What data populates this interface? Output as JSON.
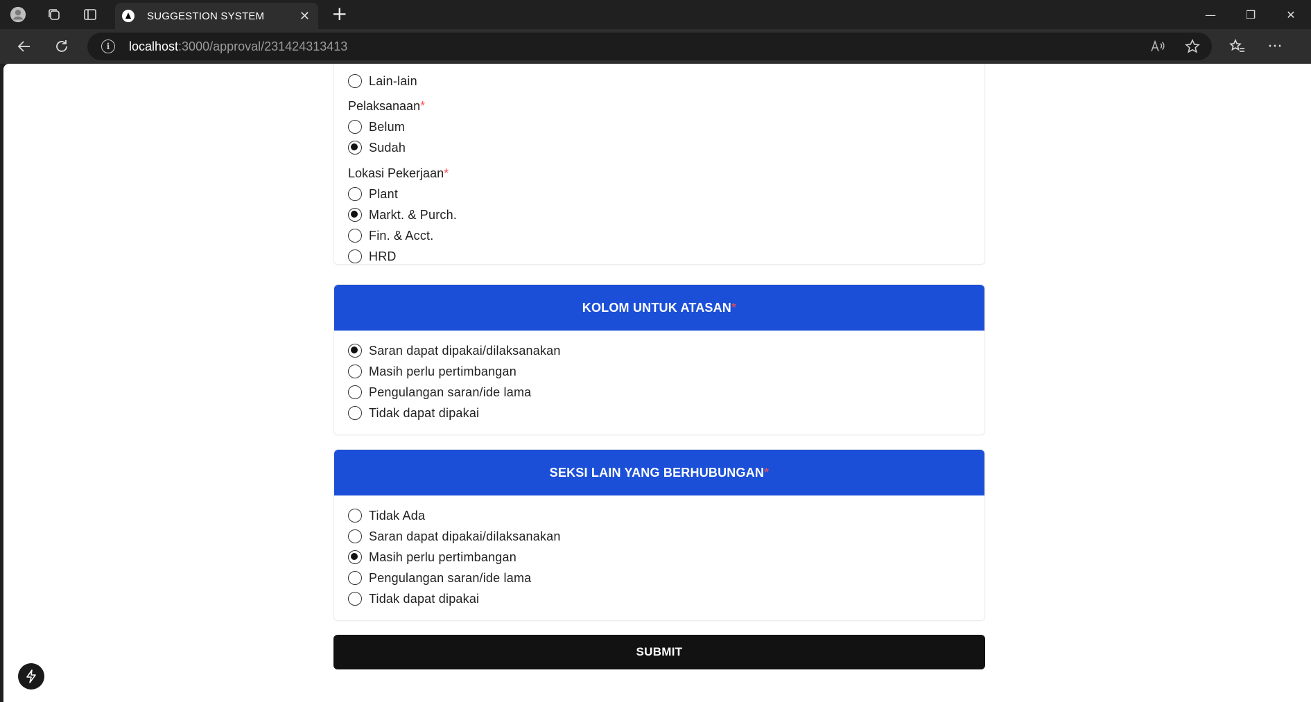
{
  "browser": {
    "tab_title": "SUGGESTION SYSTEM",
    "url_host": "localhost",
    "url_path": ":3000/approval/231424313413",
    "icons": [
      "profile-icon",
      "workspaces-icon",
      "tab-actions-icon",
      "close-icon",
      "new-tab-icon",
      "back-icon",
      "refresh-icon",
      "info-icon",
      "read-aloud-icon",
      "favorite-icon",
      "favorites-icon",
      "more-icon"
    ]
  },
  "form": {
    "top_partial_option": {
      "label": "Lain-lain",
      "checked": false
    },
    "pelaksanaan": {
      "label": "Pelaksanaan",
      "required_mark": "*",
      "options": [
        {
          "label": "Belum",
          "checked": false
        },
        {
          "label": "Sudah",
          "checked": true
        }
      ]
    },
    "lokasi": {
      "label": "Lokasi Pekerjaan",
      "required_mark": "*",
      "options": [
        {
          "label": "Plant",
          "checked": false
        },
        {
          "label": "Markt. & Purch.",
          "checked": true
        },
        {
          "label": "Fin. & Acct.",
          "checked": false
        },
        {
          "label": "HRD",
          "checked": false
        }
      ]
    },
    "atasan": {
      "title": "KOLOM UNTUK ATASAN",
      "required_mark": "*",
      "options": [
        {
          "label": "Saran dapat dipakai/dilaksanakan",
          "checked": true
        },
        {
          "label": "Masih perlu pertimbangan",
          "checked": false
        },
        {
          "label": "Pengulangan saran/ide lama",
          "checked": false
        },
        {
          "label": "Tidak dapat dipakai",
          "checked": false
        }
      ]
    },
    "seksi": {
      "title": "SEKSI LAIN YANG BERHUBUNGAN",
      "required_mark": "*",
      "options": [
        {
          "label": "Tidak Ada",
          "checked": false
        },
        {
          "label": "Saran dapat dipakai/dilaksanakan",
          "checked": false
        },
        {
          "label": "Masih perlu pertimbangan",
          "checked": true
        },
        {
          "label": "Pengulangan saran/ide lama",
          "checked": false
        },
        {
          "label": "Tidak dapat dipakai",
          "checked": false
        }
      ]
    },
    "submit_label": "SUBMIT"
  },
  "colors": {
    "header_blue": "#1b4fd8",
    "required_red": "#ff4d4f",
    "submit_black": "#121212"
  }
}
